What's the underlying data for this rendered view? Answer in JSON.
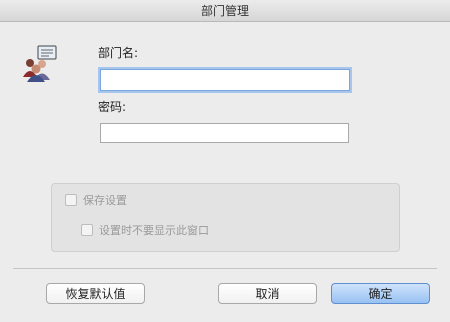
{
  "window": {
    "title": "部门管理"
  },
  "form": {
    "department_label": "部门名:",
    "department_value": "",
    "password_label": "密码:",
    "password_value": ""
  },
  "settings": {
    "save_settings_label": "保存设置",
    "dont_show_label": "设置时不要显示此窗口"
  },
  "buttons": {
    "restore_default": "恢复默认值",
    "cancel": "取消",
    "ok": "确定"
  },
  "icons": {
    "app": "users-group-icon"
  },
  "colors": {
    "focus_ring": "#a7c6ee",
    "default_button": "#97c1f2"
  }
}
